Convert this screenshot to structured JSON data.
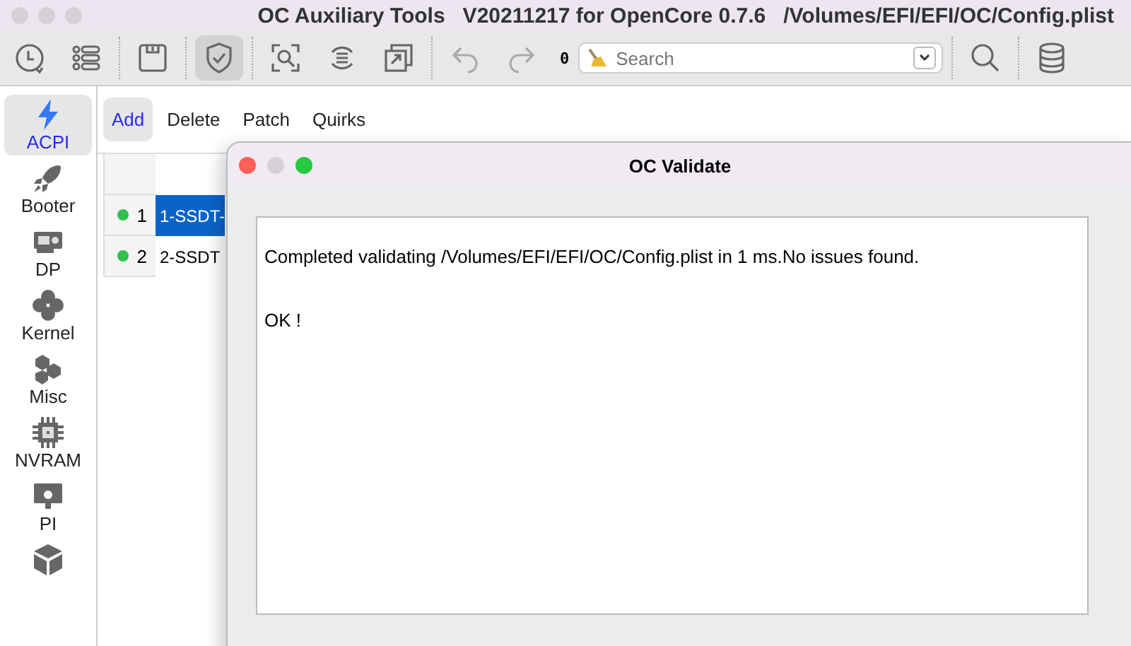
{
  "window": {
    "title": "OC Auxiliary Tools   V20211217 for OpenCore 0.7.6   /Volumes/EFI/EFI/OC/Config.plist"
  },
  "toolbar": {
    "buttons": [
      {
        "kind": "clock",
        "selected": false
      },
      {
        "kind": "list",
        "selected": false
      },
      {
        "kind": "save",
        "selected": false
      },
      {
        "kind": "shield",
        "selected": true
      },
      {
        "kind": "scan",
        "selected": false
      },
      {
        "kind": "cycle",
        "selected": false
      },
      {
        "kind": "copy",
        "selected": false
      },
      {
        "kind": "undo",
        "selected": false
      },
      {
        "kind": "redo",
        "selected": false
      }
    ],
    "counter": "0",
    "search": {
      "placeholder": "Search"
    }
  },
  "sidebar": {
    "items": [
      {
        "kind": "bolt",
        "label": "ACPI",
        "selected": true
      },
      {
        "kind": "rocket",
        "label": "Booter",
        "selected": false
      },
      {
        "kind": "card",
        "label": "DP",
        "selected": false
      },
      {
        "kind": "clover",
        "label": "Kernel",
        "selected": false
      },
      {
        "kind": "hex",
        "label": "Misc",
        "selected": false
      },
      {
        "kind": "chip",
        "label": "NVRAM",
        "selected": false
      },
      {
        "kind": "monitor",
        "label": "PI",
        "selected": false
      },
      {
        "kind": "cube",
        "selected": false
      }
    ]
  },
  "tabs": [
    {
      "label": "Add",
      "selected": true
    },
    {
      "label": "Delete",
      "selected": false
    },
    {
      "label": "Patch",
      "selected": false
    },
    {
      "label": "Quirks",
      "selected": false
    }
  ],
  "table": {
    "rows": [
      {
        "number": "1",
        "color": "#30c050",
        "column_2": "1-SSDT-",
        "selected": true
      },
      {
        "number": "2",
        "color": "#30c050",
        "column_2": "2-SSDT",
        "selected": false
      }
    ]
  },
  "dialog": {
    "title": "OC Validate",
    "lines": [
      "Completed validating /Volumes/EFI/EFI/OC/Config.plist in 1 ms.No issues found.",
      "OK !"
    ]
  }
}
